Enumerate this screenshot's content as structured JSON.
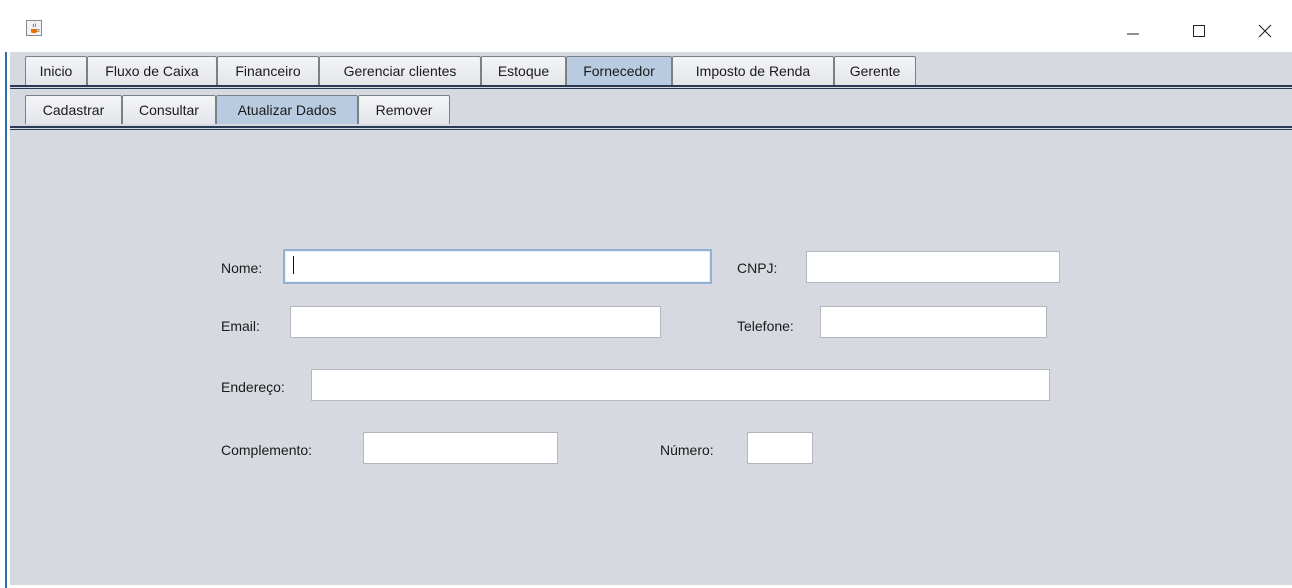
{
  "window": {
    "app_icon": "java-cup-icon",
    "controls": {
      "minimize_icon": "minimize-icon",
      "maximize_icon": "maximize-icon",
      "close_icon": "close-icon"
    }
  },
  "main_tabs": [
    {
      "label": "Inicio",
      "selected": false
    },
    {
      "label": "Fluxo de Caixa",
      "selected": false
    },
    {
      "label": "Financeiro",
      "selected": false
    },
    {
      "label": "Gerenciar clientes",
      "selected": false
    },
    {
      "label": "Estoque",
      "selected": false
    },
    {
      "label": "Fornecedor",
      "selected": true
    },
    {
      "label": "Imposto de Renda",
      "selected": false
    },
    {
      "label": "Gerente",
      "selected": false
    }
  ],
  "sub_tabs": [
    {
      "label": "Cadastrar",
      "selected": false
    },
    {
      "label": "Consultar",
      "selected": false
    },
    {
      "label": "Atualizar Dados",
      "selected": true
    },
    {
      "label": "Remover",
      "selected": false
    }
  ],
  "form": {
    "nome": {
      "label": "Nome:",
      "value": ""
    },
    "cnpj": {
      "label": "CNPJ:",
      "value": ""
    },
    "email": {
      "label": "Email:",
      "value": ""
    },
    "telefone": {
      "label": "Telefone:",
      "value": ""
    },
    "endereco": {
      "label": "Endereço:",
      "value": ""
    },
    "complemento": {
      "label": "Complemento:",
      "value": ""
    },
    "numero": {
      "label": "Número:",
      "value": ""
    }
  },
  "colors": {
    "panel_bg": "#d6d9df",
    "selected_tab": "#b9cbe0",
    "focus_border": "#93b2d3"
  }
}
